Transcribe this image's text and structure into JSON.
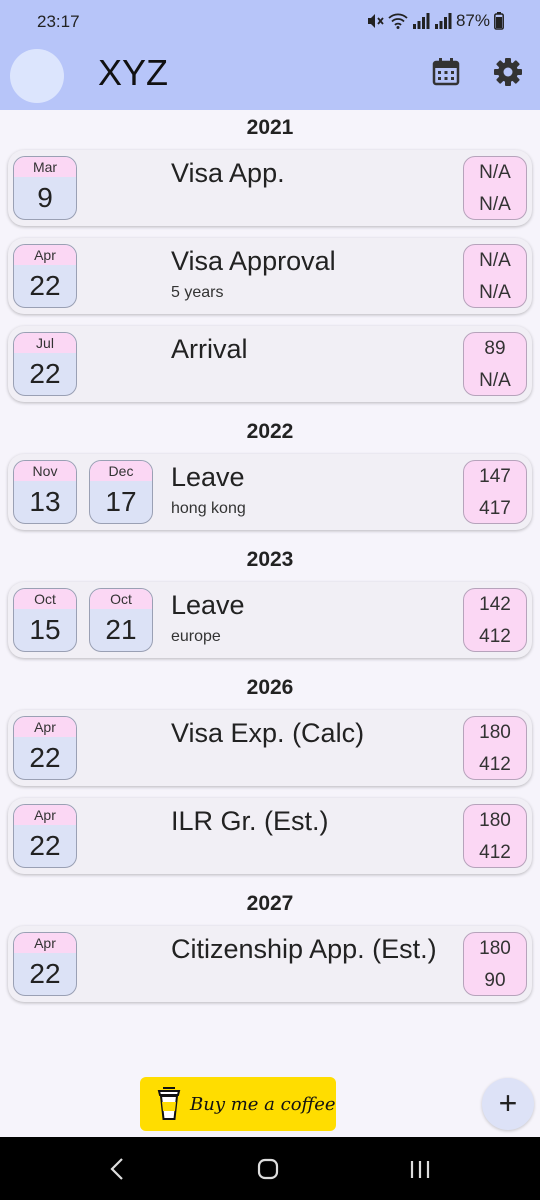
{
  "status": {
    "time": "23:17",
    "battery": "87%"
  },
  "app": {
    "title": "XYZ"
  },
  "icons": {
    "calendar": "calendar-icon",
    "settings": "gear-icon",
    "add": "plus-icon",
    "coffee": "coffee-cup-icon"
  },
  "colors": {
    "appbar": "#B7C5F9",
    "month_header": "#FBD7F4",
    "day_area": "#DCE2F6",
    "coffee": "#FFDD00"
  },
  "groups": [
    {
      "year": "2021",
      "events": [
        {
          "dates": [
            {
              "month": "Mar",
              "day": "9"
            }
          ],
          "title": "Visa App.",
          "subtitle": "",
          "top": "N/A",
          "bottom": "N/A"
        },
        {
          "dates": [
            {
              "month": "Apr",
              "day": "22"
            }
          ],
          "title": "Visa Approval",
          "subtitle": "5 years",
          "top": "N/A",
          "bottom": "N/A"
        },
        {
          "dates": [
            {
              "month": "Jul",
              "day": "22"
            }
          ],
          "title": "Arrival",
          "subtitle": "",
          "top": "89",
          "bottom": "N/A"
        }
      ]
    },
    {
      "year": "2022",
      "events": [
        {
          "dates": [
            {
              "month": "Nov",
              "day": "13"
            },
            {
              "month": "Dec",
              "day": "17"
            }
          ],
          "title": "Leave",
          "subtitle": "hong kong",
          "top": "147",
          "bottom": "417"
        }
      ]
    },
    {
      "year": "2023",
      "events": [
        {
          "dates": [
            {
              "month": "Oct",
              "day": "15"
            },
            {
              "month": "Oct",
              "day": "21"
            }
          ],
          "title": "Leave",
          "subtitle": "europe",
          "top": "142",
          "bottom": "412"
        }
      ]
    },
    {
      "year": "2026",
      "events": [
        {
          "dates": [
            {
              "month": "Apr",
              "day": "22"
            }
          ],
          "title": "Visa Exp. (Calc)",
          "subtitle": "",
          "top": "180",
          "bottom": "412"
        },
        {
          "dates": [
            {
              "month": "Apr",
              "day": "22"
            }
          ],
          "title": "ILR Gr. (Est.)",
          "subtitle": "",
          "top": "180",
          "bottom": "412"
        }
      ]
    },
    {
      "year": "2027",
      "events": [
        {
          "dates": [
            {
              "month": "Apr",
              "day": "22"
            }
          ],
          "title": "Citizenship App. (Est.)",
          "subtitle": "",
          "top": "180",
          "bottom": "90"
        }
      ]
    }
  ],
  "coffee": {
    "label": "Buy me a coffee"
  },
  "fab": {
    "label": "+"
  }
}
